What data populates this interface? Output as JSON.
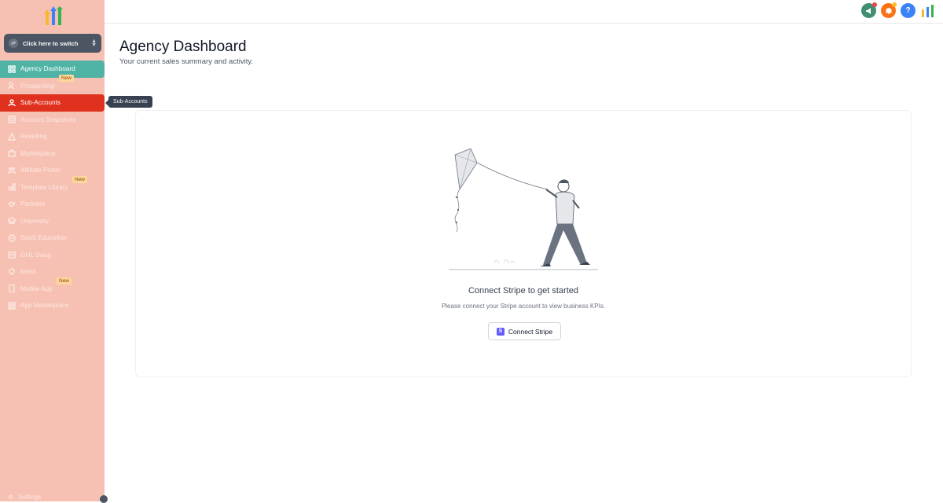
{
  "sidebar": {
    "switcher_label": "Click here to switch",
    "items": [
      {
        "label": "Agency Dashboard",
        "icon": "dashboard-icon",
        "state": "active"
      },
      {
        "label": "Prospecting",
        "icon": "prospect-icon",
        "badge": "New"
      },
      {
        "label": "Sub-Accounts",
        "icon": "user-icon",
        "state": "hover"
      },
      {
        "label": "Account Snapshots",
        "icon": "snapshot-icon"
      },
      {
        "label": "Reselling",
        "icon": "reselling-icon"
      },
      {
        "label": "Marketplace",
        "icon": "bag-icon"
      },
      {
        "label": "Affiliate Portal",
        "icon": "affiliate-icon"
      },
      {
        "label": "Template Library",
        "icon": "template-icon",
        "badge": "New"
      },
      {
        "label": "Partners",
        "icon": "handshake-icon"
      },
      {
        "label": "University",
        "icon": "graduation-icon"
      },
      {
        "label": "SaaS Education",
        "icon": "saas-icon"
      },
      {
        "label": "GHL Swag",
        "icon": "swag-icon"
      },
      {
        "label": "Ideas",
        "icon": "lightbulb-icon"
      },
      {
        "label": "Mobile App",
        "icon": "mobile-icon",
        "badge": "New"
      },
      {
        "label": "App Marketplace",
        "icon": "apps-icon"
      }
    ],
    "tooltip": "Sub-Accounts",
    "settings_label": "Settings"
  },
  "header": {
    "icons": [
      {
        "name": "announcement-icon",
        "color": "#3f8f70"
      },
      {
        "name": "bell-icon",
        "color": "#f97316"
      },
      {
        "name": "help-icon",
        "color": "#3b82f6",
        "glyph": "?"
      },
      {
        "name": "app-logo-icon"
      }
    ]
  },
  "main": {
    "title": "Agency Dashboard",
    "subtitle": "Your current sales summary and activity.",
    "empty_state": {
      "title": "Connect Stripe to get started",
      "description": "Please connect your Stripe account to view business KPIs.",
      "button_label": "Connect Stripe"
    }
  },
  "colors": {
    "sidebar_bg": "#f6c1b3",
    "active_item": "#4fb3a6",
    "hover_item": "#e0301e"
  }
}
